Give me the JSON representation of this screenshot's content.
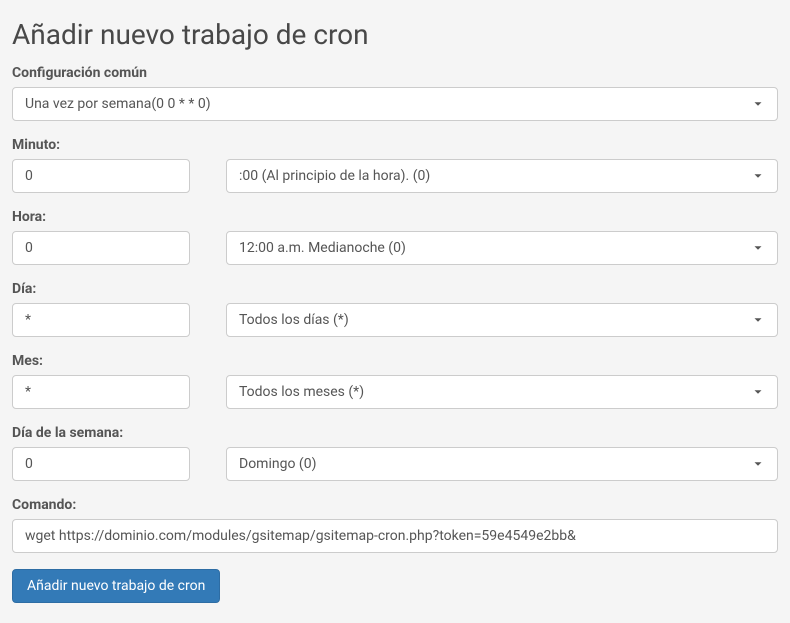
{
  "title": "Añadir nuevo trabajo de cron",
  "common": {
    "label": "Configuración común",
    "selected": "Una vez por semana(0 0 * * 0)"
  },
  "minute": {
    "label": "Minuto:",
    "value": "0",
    "preset": ":00 (Al principio de la hora). (0)"
  },
  "hour": {
    "label": "Hora:",
    "value": "0",
    "preset": "12:00 a.m. Medianoche (0)"
  },
  "day": {
    "label": "Día:",
    "value": "*",
    "preset": "Todos los días (*)"
  },
  "month": {
    "label": "Mes:",
    "value": "*",
    "preset": "Todos los meses (*)"
  },
  "weekday": {
    "label": "Día de la semana:",
    "value": "0",
    "preset": "Domingo (0)"
  },
  "command": {
    "label": "Comando:",
    "value": "wget https://dominio.com/modules/gsitemap/gsitemap-cron.php?token=59e4549e2bb&"
  },
  "submit": {
    "label": "Añadir nuevo trabajo de cron"
  }
}
